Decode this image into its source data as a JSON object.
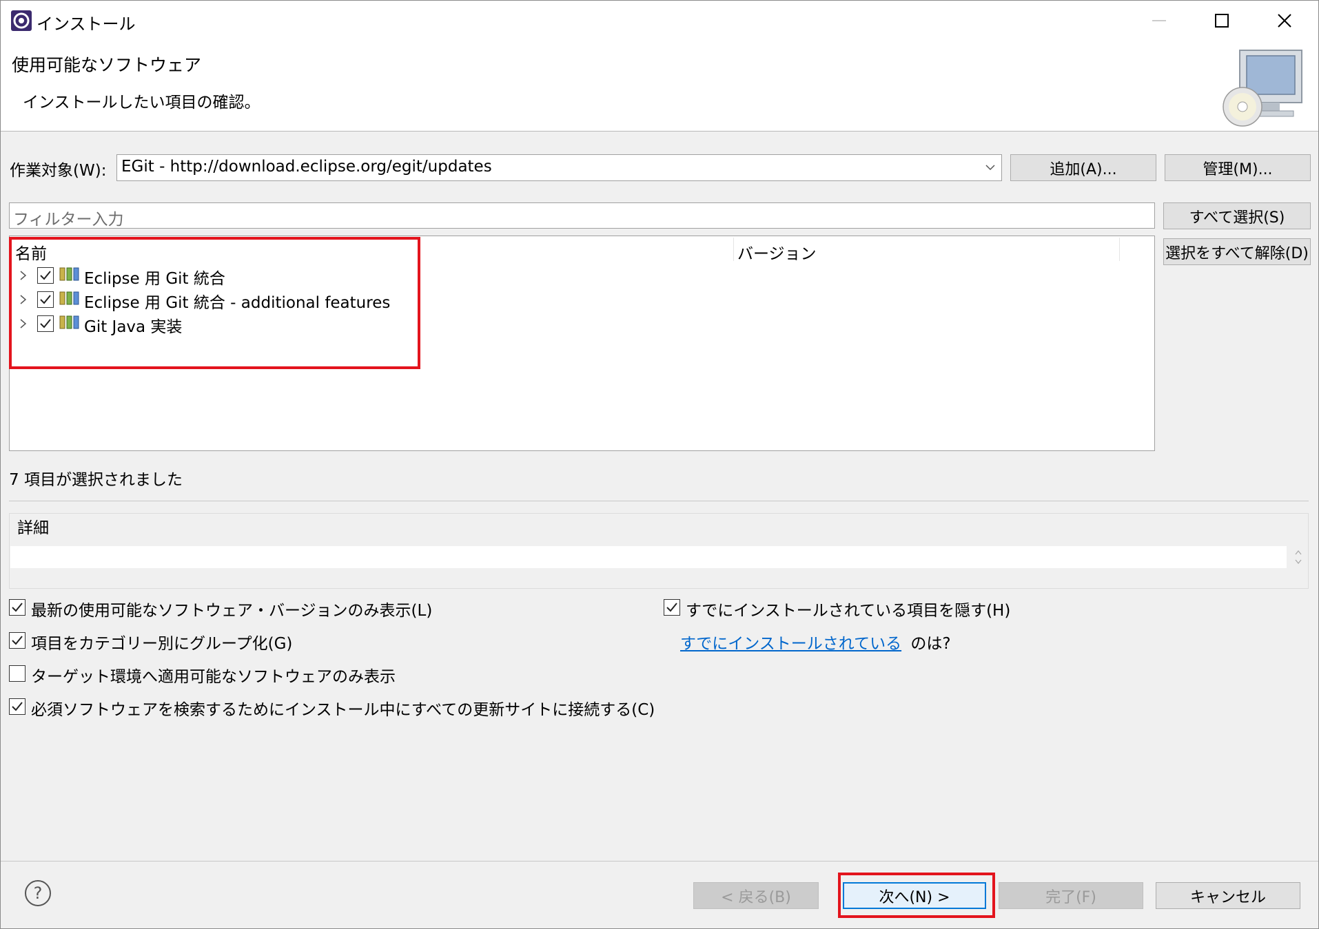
{
  "window": {
    "title": "インストール"
  },
  "banner": {
    "title": "使用可能なソフトウェア",
    "description": "インストールしたい項目の確認。"
  },
  "work_with": {
    "label": "作業対象(W):",
    "value": "EGit - http://download.eclipse.org/egit/updates",
    "add_button": "追加(A)...",
    "manage_button": "管理(M)..."
  },
  "filter": {
    "placeholder": "フィルター入力"
  },
  "side_buttons": {
    "select_all": "すべて選択(S)",
    "deselect_all": "選択をすべて解除(D)"
  },
  "tree": {
    "columns": [
      "名前",
      "バージョン"
    ],
    "items": [
      {
        "label": "Eclipse 用 Git 統合",
        "checked": true
      },
      {
        "label": "Eclipse 用 Git 統合 - additional features",
        "checked": true
      },
      {
        "label": "Git Java 実装",
        "checked": true
      }
    ]
  },
  "selection_status": "7 項目が選択されました",
  "details": {
    "label": "詳細"
  },
  "options": {
    "latest_only": {
      "label": "最新の使用可能なソフトウェア・バージョンのみ表示(L)",
      "checked": true
    },
    "group_by_category": {
      "label": "項目をカテゴリー別にグループ化(G)",
      "checked": true
    },
    "target_env_only": {
      "label": "ターゲット環境へ適用可能なソフトウェアのみ表示",
      "checked": false
    },
    "contact_all_sites": {
      "label": "必須ソフトウェアを検索するためにインストール中にすべての更新サイトに接続する(C)",
      "checked": true
    },
    "hide_installed": {
      "label": "すでにインストールされている項目を隠す(H)",
      "checked": true
    },
    "installed_link": "すでにインストールされている",
    "installed_suffix": "のは?"
  },
  "footer": {
    "back": "< 戻る(B)",
    "next": "次へ(N) >",
    "finish": "完了(F)",
    "cancel": "キャンセル"
  },
  "colors": {
    "highlight": "#e3141d",
    "link": "#0066cc",
    "focus": "#0078d7"
  }
}
